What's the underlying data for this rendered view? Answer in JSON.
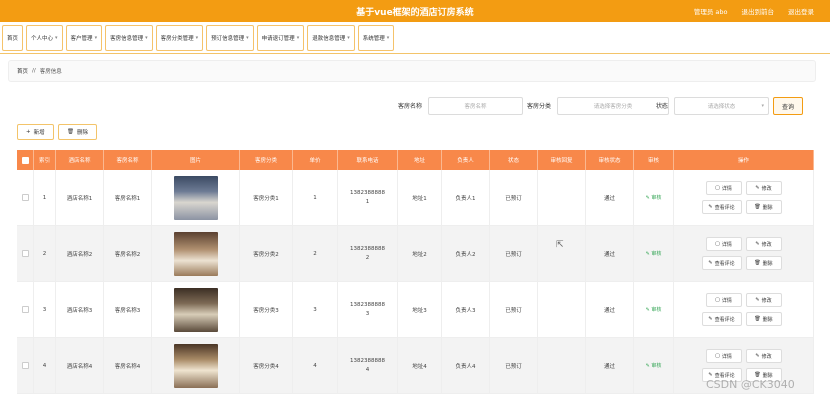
{
  "header": {
    "title": "基于vue框架的酒店订房系统",
    "user": "管理员 abo",
    "back_to_front": "退出到前台",
    "logout": "退出登录"
  },
  "nav": [
    {
      "label": "首页",
      "has_menu": false
    },
    {
      "label": "个人中心",
      "has_menu": true
    },
    {
      "label": "客户管理",
      "has_menu": true
    },
    {
      "label": "客房信息管理",
      "has_menu": true
    },
    {
      "label": "客房分类管理",
      "has_menu": true
    },
    {
      "label": "预订信息管理",
      "has_menu": true
    },
    {
      "label": "申请退订管理",
      "has_menu": true
    },
    {
      "label": "退款信息管理",
      "has_menu": true
    },
    {
      "label": "系统管理",
      "has_menu": true
    }
  ],
  "breadcrumb": {
    "home": "首页",
    "sep": "//",
    "current": "客房信息"
  },
  "filters": {
    "name_label": "客房名称",
    "name_placeholder": "客房名称",
    "category_label": "客房分类",
    "category_placeholder": "请选择客房分类",
    "status_label": "状态",
    "status_placeholder": "请选择状态",
    "search": "查询"
  },
  "actions": {
    "add": "新增",
    "delete": "删除"
  },
  "table": {
    "columns": [
      "索引",
      "酒店名称",
      "客房名称",
      "图片",
      "客房分类",
      "单价",
      "联系电话",
      "地址",
      "负责人",
      "状态",
      "审核回复",
      "审核状态",
      "审核",
      "操作"
    ],
    "audit_link": "审核",
    "op_detail": "详情",
    "op_edit": "修改",
    "op_review": "查看评论",
    "op_delete": "删除",
    "rows": [
      {
        "index": "1",
        "hotel": "酒店名称1",
        "room": "客房名称1",
        "category": "客房分类1",
        "price": "1",
        "phone1": "1382388888",
        "phone2": "1",
        "address": "地址1",
        "manager": "负责人1",
        "status": "已预订",
        "reply": "",
        "audit_status": "通过"
      },
      {
        "index": "2",
        "hotel": "酒店名称2",
        "room": "客房名称2",
        "category": "客房分类2",
        "price": "2",
        "phone1": "1382388888",
        "phone2": "2",
        "address": "地址2",
        "manager": "负责人2",
        "status": "已预订",
        "reply": "",
        "audit_status": "通过"
      },
      {
        "index": "3",
        "hotel": "酒店名称3",
        "room": "客房名称3",
        "category": "客房分类3",
        "price": "3",
        "phone1": "1382388888",
        "phone2": "3",
        "address": "地址3",
        "manager": "负责人3",
        "status": "已预订",
        "reply": "",
        "audit_status": "通过"
      },
      {
        "index": "4",
        "hotel": "酒店名称4",
        "room": "客房名称4",
        "category": "客房分类4",
        "price": "4",
        "phone1": "1382388888",
        "phone2": "4",
        "address": "地址4",
        "manager": "负责人4",
        "status": "已预订",
        "reply": "",
        "audit_status": "通过"
      }
    ]
  },
  "watermark": "CSDN @CK3040",
  "colors": {
    "header": "#f39c12",
    "table_header": "#f8884a",
    "audit_green": "#3aa85a"
  }
}
